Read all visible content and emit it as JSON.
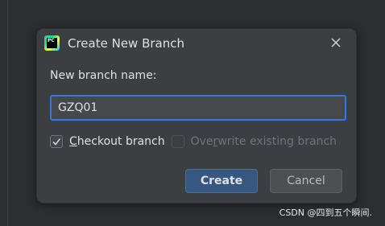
{
  "dialog": {
    "title": "Create New Branch",
    "app_icon_text": "PC",
    "branch_label": "New branch name:",
    "branch_value": "GZQ01",
    "checkout": {
      "label_first": "C",
      "label_rest": "heckout branch",
      "checked": true
    },
    "overwrite": {
      "label_before": "Ove",
      "label_underlined": "r",
      "label_after": "write existing branch",
      "checked": false,
      "disabled": true
    },
    "create_label": "Create",
    "cancel_label": "Cancel"
  },
  "watermark": "CSDN @四到五个瞬间.",
  "colors": {
    "dialog_bg": "#3c3f41",
    "focus_border": "#3574f0",
    "primary_button": "#365880"
  },
  "icons": {
    "app": "pycharm-logo-icon",
    "close": "close-icon",
    "check": "checkmark-icon"
  }
}
